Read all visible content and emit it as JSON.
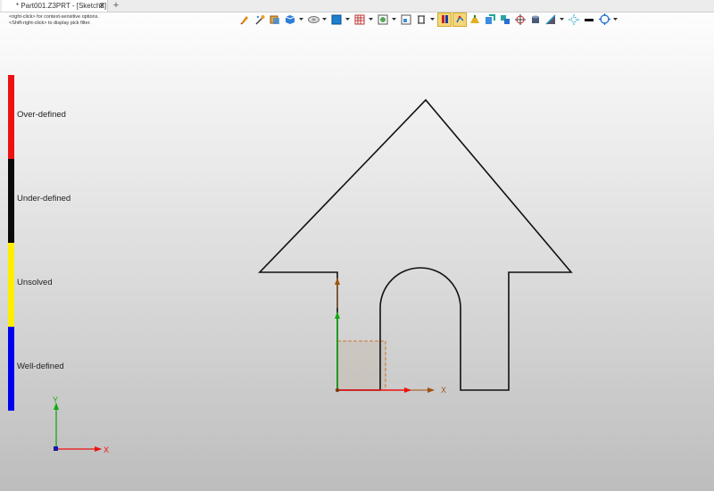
{
  "tab": {
    "title": "* Part001.Z3PRT - [Sketch2]",
    "close_glyph": "✕",
    "add_glyph": "+"
  },
  "hints": {
    "line1": "<right-click> for context-sensitive options.",
    "line2": "<Shift-right-click> to display pick filter."
  },
  "toolbar": {
    "icons": [
      "pencil-icon",
      "wand-icon",
      "cube-icon",
      "solid-cube-icon",
      "plane-icon",
      "square-icon",
      "grid-icon",
      "image-icon",
      "view-icon",
      "clamp-icon",
      "constraint-icon",
      "curve-icon",
      "highlight-icon",
      "smooth-icon",
      "stack-icon",
      "target-icon",
      "cylinder-icon",
      "light-icon",
      "line-style-icon",
      "crosshair-icon"
    ],
    "active_icons": [
      "constraint-icon",
      "curve-icon"
    ]
  },
  "legend": {
    "items": [
      {
        "label": "Over-defined",
        "color": "#ee1111"
      },
      {
        "label": "Under-defined",
        "color": "#0a0a0a"
      },
      {
        "label": "Unsolved",
        "color": "#ffee00"
      },
      {
        "label": "Well-defined",
        "color": "#0000ee"
      }
    ]
  },
  "sketch": {
    "origin_x_label": "X"
  },
  "triad": {
    "x_label": "X",
    "y_label": "Y"
  },
  "colors": {
    "x_axis": "#ee1111",
    "y_axis": "#11aa11",
    "sketch_line": "#111111",
    "sketch_axis_marker": "#a0520f"
  }
}
